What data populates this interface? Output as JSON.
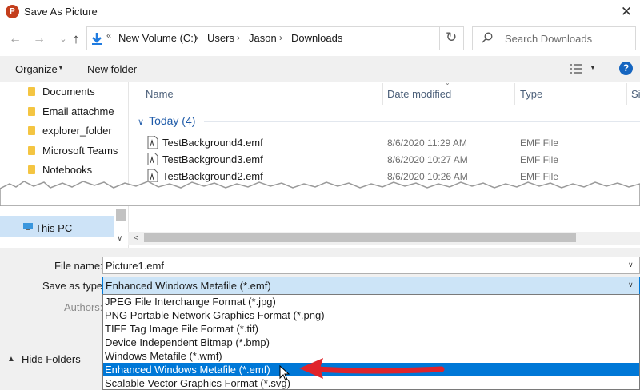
{
  "window": {
    "title": "Save As Picture",
    "app_icon_label": "P",
    "close_glyph": "✕"
  },
  "nav": {
    "back_glyph": "←",
    "forward_glyph": "→",
    "up_glyph": "↑",
    "overflow_glyph": "«",
    "breadcrumb": [
      "New Volume (C:)",
      "Users",
      "Jason",
      "Downloads"
    ],
    "separator": "›",
    "refresh_glyph": "↻",
    "search_placeholder": "Search Downloads"
  },
  "toolbar": {
    "organize": "Organize",
    "new_folder": "New folder",
    "help": "?"
  },
  "sidebar": {
    "items": [
      "Documents",
      "Email attachmen",
      "explorer_folder",
      "Microsoft Teams",
      "Notebooks"
    ],
    "this_pc": "This PC"
  },
  "columns": {
    "name": "Name",
    "date": "Date modified",
    "type": "Type",
    "size": "Siz"
  },
  "group": {
    "label": "Today (4)"
  },
  "files": [
    {
      "name": "TestBackground4.emf",
      "date": "8/6/2020 11:29 AM",
      "type": "EMF File"
    },
    {
      "name": "TestBackground3.emf",
      "date": "8/6/2020 10:27 AM",
      "type": "EMF File"
    },
    {
      "name": "TestBackground2.emf",
      "date": "8/6/2020 10:26 AM",
      "type": "EMF File"
    }
  ],
  "form": {
    "file_name_label": "File name:",
    "file_name_value": "Picture1.emf",
    "save_type_label": "Save as type:",
    "save_type_value": "Enhanced Windows Metafile (*.emf)",
    "authors_label": "Authors:"
  },
  "type_options": [
    "JPEG File Interchange Format (*.jpg)",
    "PNG Portable Network Graphics Format (*.png)",
    "TIFF Tag Image File Format (*.tif)",
    "Device Independent Bitmap (*.bmp)",
    "Windows Metafile (*.wmf)",
    "Enhanced Windows Metafile (*.emf)",
    "Scalable Vector Graphics Format (*.svg)"
  ],
  "selected_option_index": 5,
  "hide_folders": "Hide Folders",
  "colors": {
    "accent": "#0078d7",
    "annotation_arrow": "#e0242b",
    "group_header": "#1e5aa8"
  }
}
